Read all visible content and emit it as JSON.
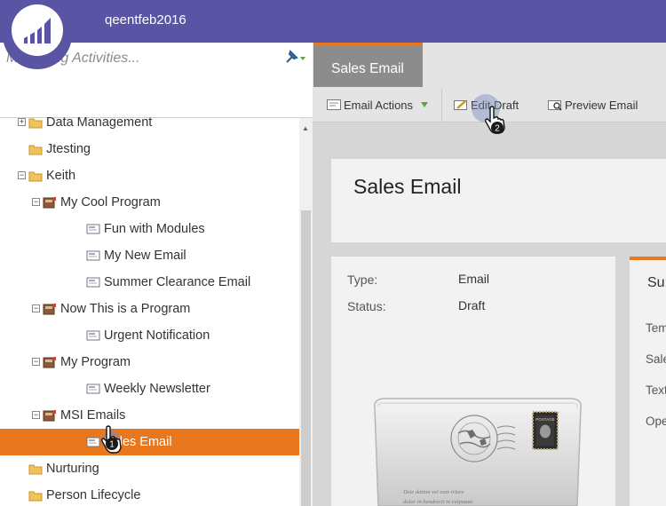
{
  "header": {
    "workspace": "qeentfeb2016",
    "logo_icon": "marketo-logo-icon",
    "accent": "#5a54a4"
  },
  "search": {
    "placeholder": "Marketing Activities...",
    "filter_icon": "pin-filter-icon"
  },
  "tree": [
    {
      "label": "Data Management",
      "icon": "folder-icon",
      "expander": "+"
    },
    {
      "label": "Jtesting",
      "icon": "folder-icon",
      "expander": ""
    },
    {
      "label": "Keith",
      "icon": "folder-icon",
      "expander": "−"
    },
    {
      "label": "My Cool Program",
      "icon": "program-icon",
      "expander": "−"
    },
    {
      "label": "Fun with Modules",
      "icon": "email-icon",
      "expander": ""
    },
    {
      "label": "My New Email",
      "icon": "email-icon",
      "expander": ""
    },
    {
      "label": "Summer Clearance Email",
      "icon": "email-icon",
      "expander": ""
    },
    {
      "label": "Now This is a Program",
      "icon": "program-icon",
      "expander": "−"
    },
    {
      "label": "Urgent Notification",
      "icon": "email-icon",
      "expander": ""
    },
    {
      "label": "My Program",
      "icon": "program-icon",
      "expander": "−"
    },
    {
      "label": "Weekly Newsletter",
      "icon": "email-icon",
      "expander": ""
    },
    {
      "label": "MSI Emails",
      "icon": "program-icon",
      "expander": "−"
    },
    {
      "label": "Sales Email",
      "icon": "email-icon",
      "expander": "",
      "selected": true
    },
    {
      "label": "Nurturing",
      "icon": "folder-icon",
      "expander": ""
    },
    {
      "label": "Person Lifecycle",
      "icon": "folder-icon",
      "expander": ""
    }
  ],
  "tab": {
    "label": "Sales Email",
    "accent": "#e8771e"
  },
  "toolbar": {
    "email_actions": "Email Actions",
    "edit_draft": "Edit Draft",
    "preview_email": "Preview Email"
  },
  "details": {
    "title": "Sales Email",
    "type_label": "Type:",
    "type_value": "Email",
    "status_label": "Status:",
    "status_value": "Draft"
  },
  "summary": {
    "title": "Su",
    "labels": [
      "Tem",
      "Sale",
      "Text",
      "Ope"
    ]
  },
  "callouts": {
    "first": "1",
    "second": "2"
  },
  "envelope": {
    "script_line_1": "Deie dation vel eum iriure",
    "script_line_2": "dolor in hendrerit in vulputate",
    "stamp_text": "POSTAGE"
  }
}
